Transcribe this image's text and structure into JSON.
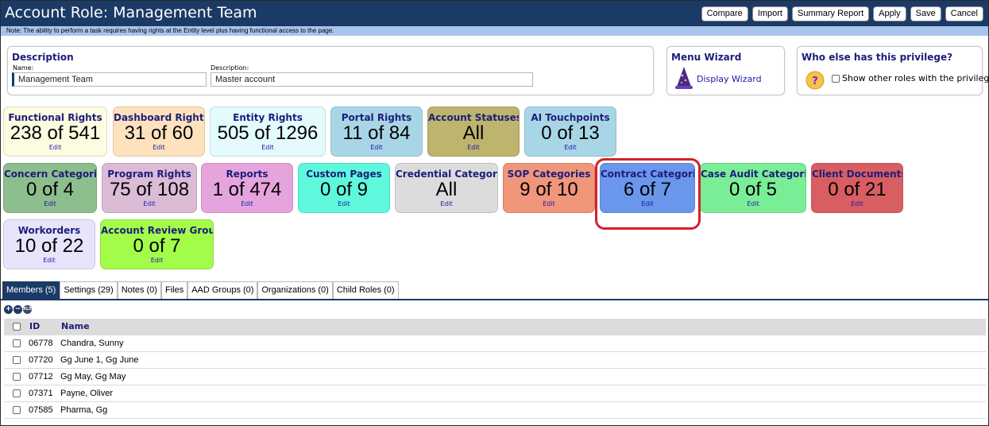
{
  "header": {
    "title": "Account Role: Management Team",
    "buttons": [
      "Compare",
      "Import",
      "Summary Report",
      "Apply",
      "Save",
      "Cancel"
    ]
  },
  "note": "Note: The ability to perform a task requires having rights at the Entity level plus having functional access to the page.",
  "description_panel": {
    "title": "Description",
    "name_label": "Name:",
    "name_value": "Management Team",
    "description_label": "Description:",
    "description_value": "Master account"
  },
  "menu_wizard": {
    "title": "Menu Wizard",
    "link": "Display Wizard"
  },
  "who_else": {
    "title": "Who else has this privilege?",
    "checkbox_label": "Show other roles with the privileges"
  },
  "tiles": [
    {
      "title": "Functional Rights",
      "value": "238 of 541",
      "edit": "Edit",
      "color": "#fdfbe0"
    },
    {
      "title": "Dashboard Rights",
      "value": "31 of 60",
      "edit": "Edit",
      "color": "#fde2bd"
    },
    {
      "title": "Entity Rights",
      "value": "505 of 1296",
      "edit": "Edit",
      "color": "#e3fbfd"
    },
    {
      "title": "Portal Rights",
      "value": "11 of 84",
      "edit": "Edit",
      "color": "#a9d6e6"
    },
    {
      "title": "Account Statuses",
      "value": "All",
      "edit": "Edit",
      "color": "#bdb46e"
    },
    {
      "title": "AI Touchpoints",
      "value": "0 of 13",
      "edit": "Edit",
      "color": "#a9d6e6"
    },
    {
      "title": "Concern Categories",
      "value": "0 of 4",
      "edit": "Edit",
      "color": "#8dbe8d"
    },
    {
      "title": "Program Rights",
      "value": "75 of 108",
      "edit": "Edit",
      "color": "#dcbbd6"
    },
    {
      "title": "Reports",
      "value": "1 of 474",
      "edit": "Edit",
      "color": "#e6a4dc"
    },
    {
      "title": "Custom Pages",
      "value": "0 of 9",
      "edit": "Edit",
      "color": "#5ef8dc"
    },
    {
      "title": "Credential Categories",
      "value": "All",
      "edit": "Edit",
      "color": "#dcdcdc"
    },
    {
      "title": "SOP Categories",
      "value": "9 of 10",
      "edit": "Edit",
      "color": "#f0967a"
    },
    {
      "title": "Contract Categories",
      "value": "6 of 7",
      "edit": "Edit",
      "color": "#6a96ec"
    },
    {
      "title": "Case Audit Categories",
      "value": "0 of 5",
      "edit": "Edit",
      "color": "#7aee96"
    },
    {
      "title": "Client Documents",
      "value": "0 of 21",
      "edit": "Edit",
      "color": "#d85e62"
    },
    {
      "title": "Workorders",
      "value": "10 of 22",
      "edit": "Edit",
      "color": "#e7e4fb"
    },
    {
      "title": "Account Review Groups",
      "value": "0 of 7",
      "edit": "Edit",
      "color": "#a3fc4a"
    }
  ],
  "tabs": [
    "Members (5)",
    "Settings (29)",
    "Notes (0)",
    "Files",
    "AAD Groups (0)",
    "Organizations (0)",
    "Child Roles (0)"
  ],
  "table": {
    "headers": [
      "ID",
      "Name"
    ],
    "rows": [
      {
        "id": "06778",
        "name": "Chandra, Sunny"
      },
      {
        "id": "07720",
        "name": "Gg June 1, Gg June"
      },
      {
        "id": "07712",
        "name": "Gg May, Gg May"
      },
      {
        "id": "07371",
        "name": "Payne, Oliver"
      },
      {
        "id": "07585",
        "name": "Pharma, Gg"
      }
    ]
  }
}
